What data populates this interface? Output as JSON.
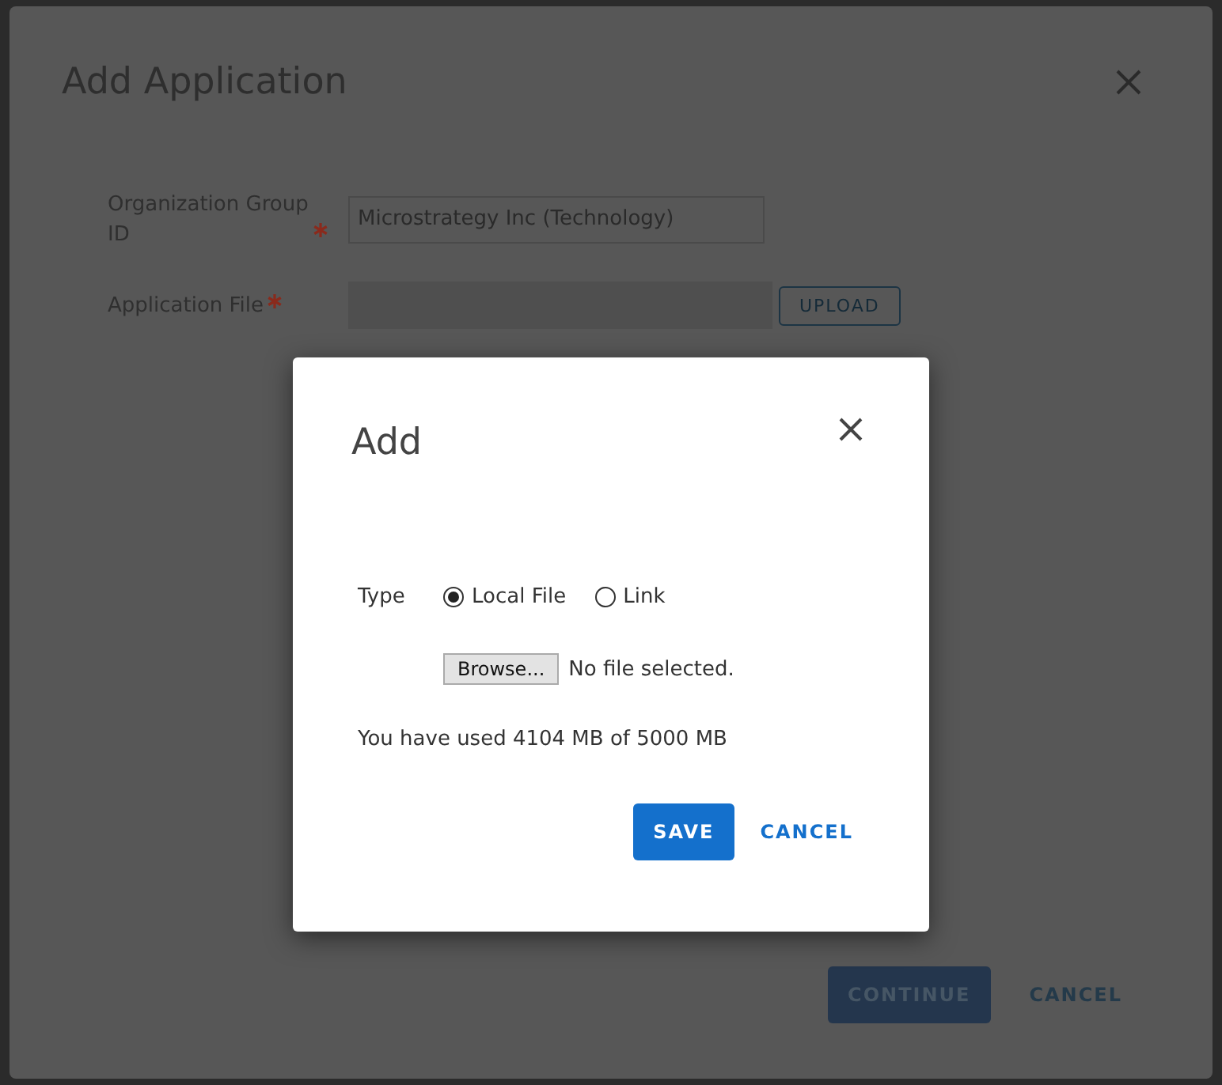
{
  "window": {
    "title": "Add Application"
  },
  "form": {
    "fields": [
      {
        "kind": "text",
        "label": "Organization Group ID",
        "required": true,
        "value": "Microstrategy Inc (Technology)"
      },
      {
        "kind": "file",
        "label": "Application File",
        "required": true,
        "button": "UPLOAD"
      }
    ]
  },
  "footer": {
    "primary": "CONTINUE",
    "secondary": "CANCEL"
  },
  "modal": {
    "title": "Add",
    "type_label": "Type",
    "options": [
      {
        "label": "Local File",
        "selected": true
      },
      {
        "label": "Link",
        "selected": false
      }
    ],
    "browse_button": "Browse...",
    "file_status": "No file selected.",
    "usage": "You have used 4104 MB of 5000 MB",
    "save": "SAVE",
    "cancel": "CANCEL"
  }
}
